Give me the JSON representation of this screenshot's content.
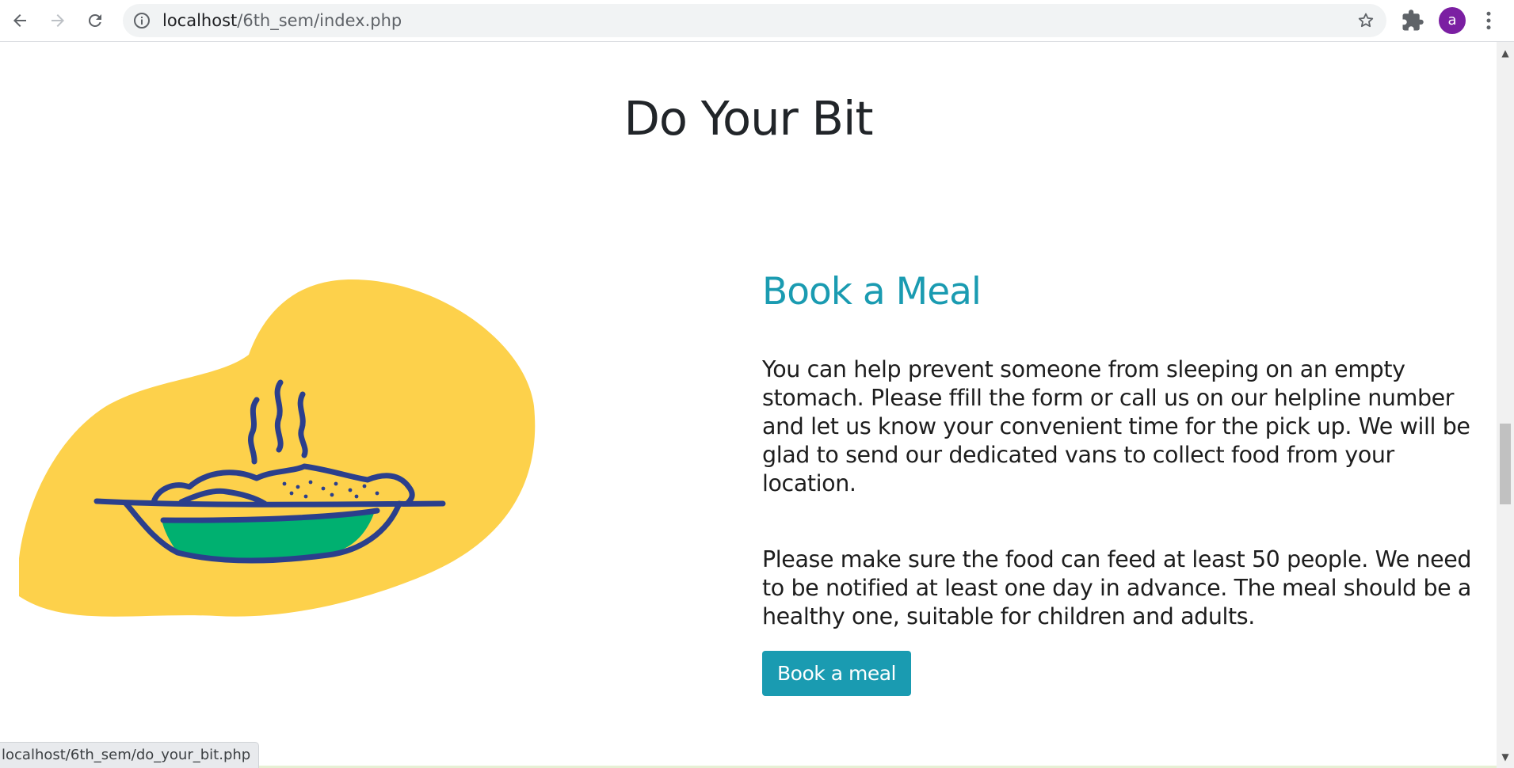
{
  "browser": {
    "url_host": "localhost",
    "url_path": "/6th_sem/index.php",
    "profile_initial": "a"
  },
  "page": {
    "section_title": "Do Your Bit",
    "card": {
      "title": "Book a Meal",
      "paragraph1": "You can help prevent someone from sleeping on an empty stomach. Please ffill the form or call us on our helpline number and let us know your convenient time for the pick up. We will be glad to send our dedicated vans to collect food from your location.",
      "paragraph2": "Please make sure the food can feed at least 50 people. We need to be notified at least one day in advance. The meal should be a healthy one, suitable for children and adults.",
      "button_label": "Book a meal"
    }
  },
  "status_bar": {
    "link_url": "localhost/6th_sem/do_your_bit.php"
  },
  "colors": {
    "accent": "#1a9bb1",
    "blob": "#fdd14b",
    "dish_outline": "#2b3f8c",
    "dish_fill": "#00b070",
    "avatar": "#7b1fa2"
  }
}
